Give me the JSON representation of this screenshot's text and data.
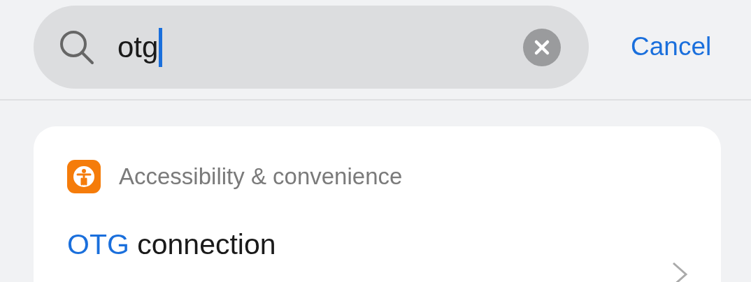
{
  "search": {
    "value": "otg",
    "focused": true
  },
  "cancel": "Cancel",
  "results": [
    {
      "category": "Accessibility & convenience",
      "title_match": "OTG",
      "title_rest": " connection"
    }
  ]
}
